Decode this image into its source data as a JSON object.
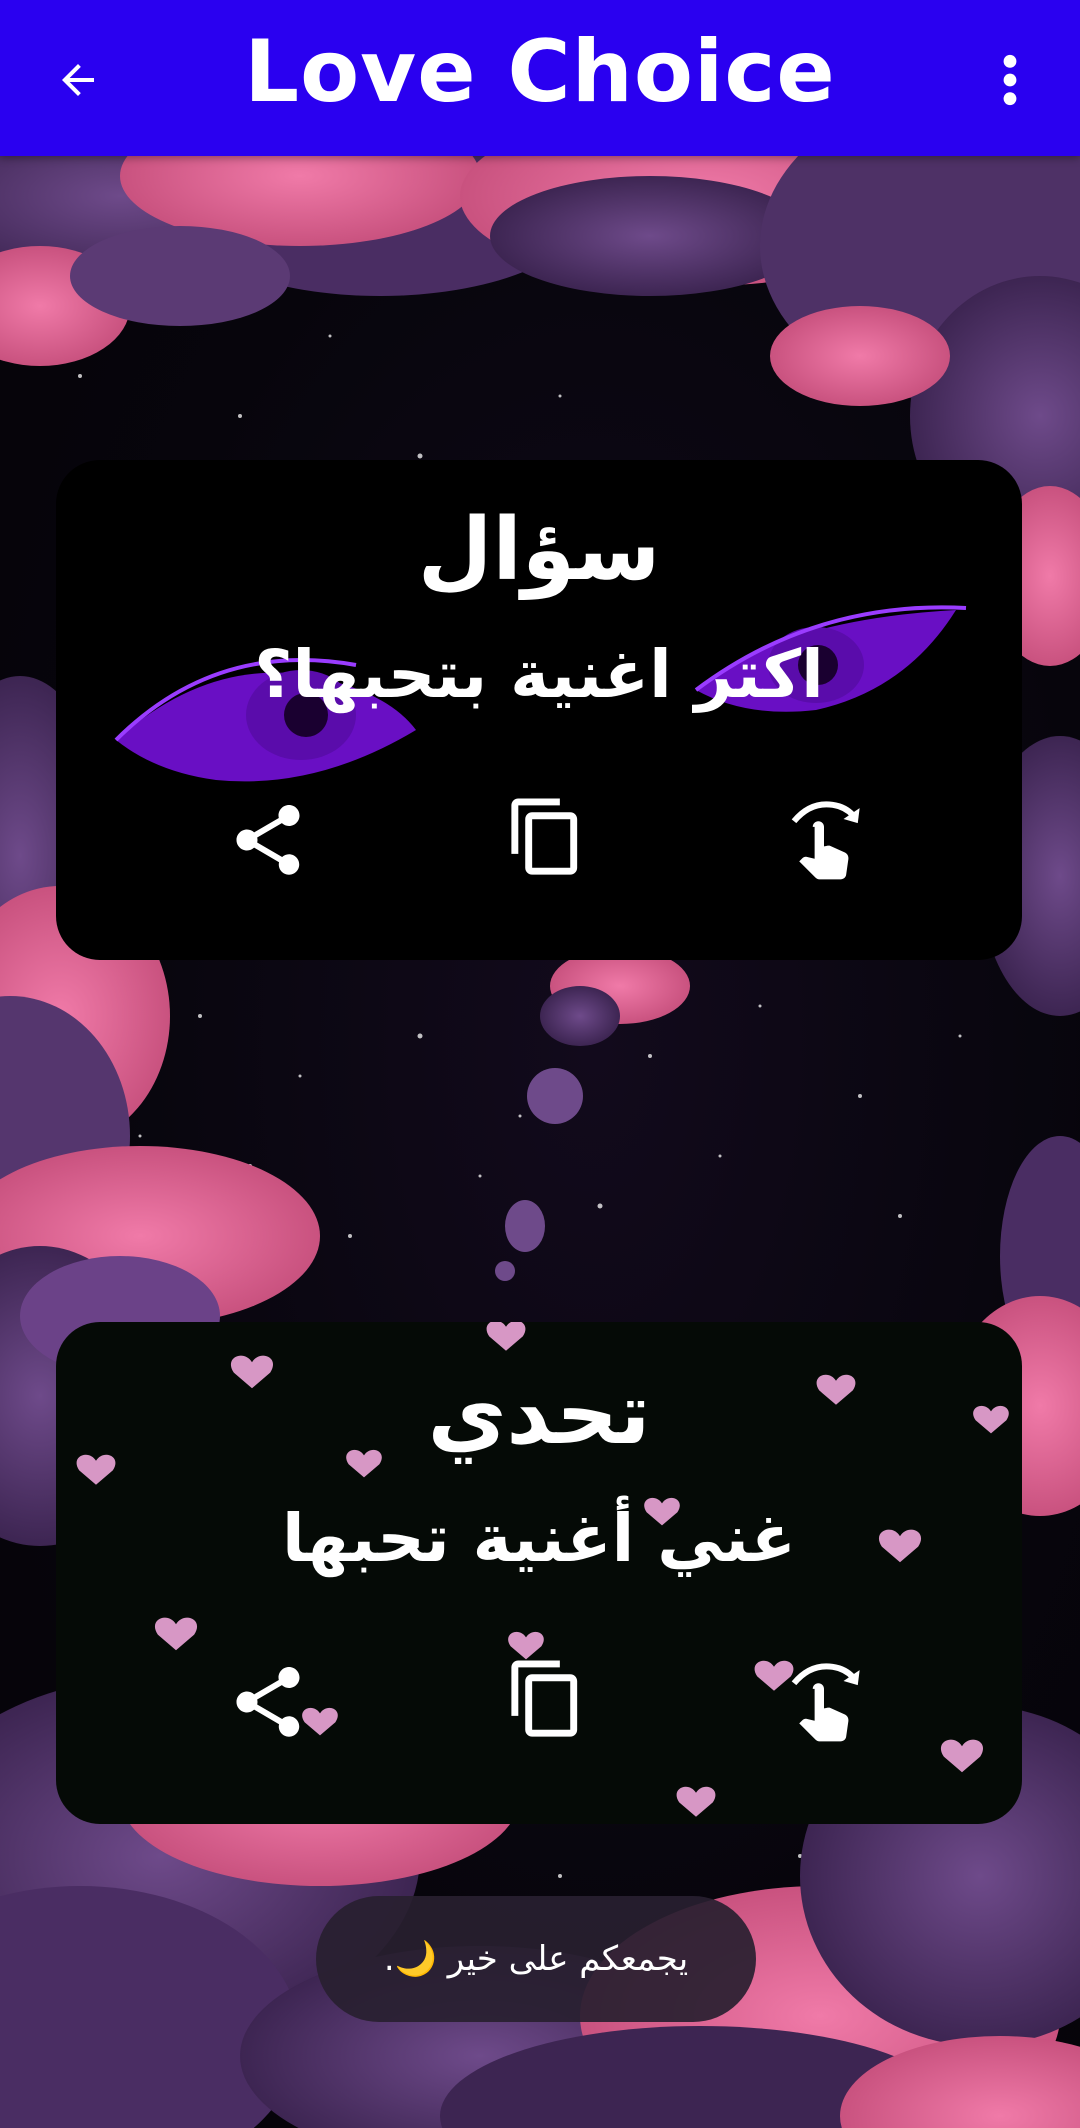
{
  "app_bar": {
    "title": "Love Choice",
    "back_icon": "arrow-back-icon",
    "menu_icon": "more-vert-icon",
    "color": "#2a00f0"
  },
  "question_card": {
    "title": "سؤال",
    "text": "اكتر اغنية بتحبها؟",
    "actions": [
      "share-icon",
      "copy-icon",
      "tap-refresh-icon"
    ]
  },
  "challenge_card": {
    "title": "تحدي",
    "text": "غني أغنية تحبها",
    "actions": [
      "share-icon",
      "copy-icon",
      "tap-refresh-icon"
    ]
  },
  "toast": {
    "text": "يجمعكم على خير 🌙."
  },
  "colors": {
    "cloud_pink": "#e66a9a",
    "cloud_purple": "#5a3a72",
    "eye_purple": "#8a1cf0",
    "heart_pink": "#f0a8dc"
  }
}
